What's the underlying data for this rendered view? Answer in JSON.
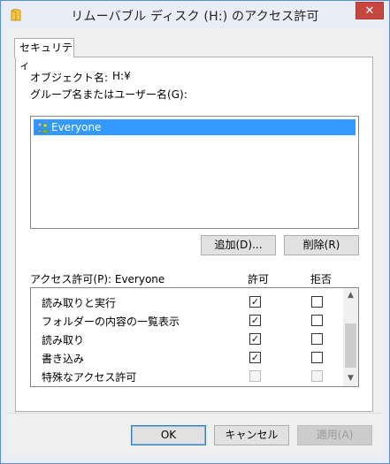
{
  "window": {
    "title": "リムーバブル ディスク (H:) のアクセス許可",
    "close_label": "✕"
  },
  "tab": {
    "label": "セキュリティ"
  },
  "object": {
    "label": "オブジェクト名:",
    "value": "H:¥"
  },
  "groups": {
    "label": "グループ名またはユーザー名(G):",
    "items": [
      {
        "label": "Everyone",
        "icon": "users-icon",
        "selected": true
      }
    ]
  },
  "buttons": {
    "add": "追加(D)...",
    "remove": "削除(R)",
    "ok": "OK",
    "cancel": "キャンセル",
    "apply": "適用(A)"
  },
  "permissions": {
    "header": "アクセス許可(P): Everyone",
    "allow_header": "許可",
    "deny_header": "拒否",
    "rows": [
      {
        "name": "読み取りと実行",
        "allow": true,
        "deny": false,
        "enabled": true
      },
      {
        "name": "フォルダーの内容の一覧表示",
        "allow": true,
        "deny": false,
        "enabled": true
      },
      {
        "name": "読み取り",
        "allow": true,
        "deny": false,
        "enabled": true
      },
      {
        "name": "書き込み",
        "allow": true,
        "deny": false,
        "enabled": true
      },
      {
        "name": "特殊なアクセス許可",
        "allow": false,
        "deny": false,
        "enabled": false
      }
    ]
  },
  "colors": {
    "selection": "#3399ff",
    "close_button": "#c7463f",
    "window_border": "#5d8fd0"
  }
}
